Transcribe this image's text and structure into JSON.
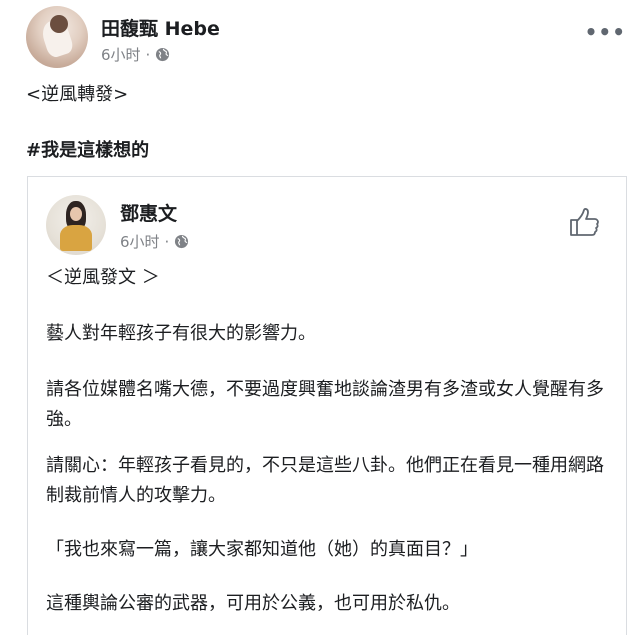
{
  "post": {
    "author": "田馥甄 Hebe",
    "time": "6小时",
    "separator": "·",
    "line1": "<逆風轉發>",
    "line2": "#我是這樣想的",
    "more_label": "•••",
    "icons": {
      "avatar": "author-avatar",
      "globe": "globe-icon",
      "more": "more-options-icon"
    }
  },
  "shared": {
    "author": "鄧惠文",
    "time": "6小时",
    "separator": "·",
    "paragraphs": [
      "＜逆風發文 ＞",
      "藝人對年輕孩子有很大的影響力。",
      "請各位媒體名嘴大德，不要過度興奮地談論渣男有多渣或女人覺醒有多強。",
      "請關心：年輕孩子看見的，不只是這些八卦。他們正在看見一種用網路制裁前情人的攻擊力。",
      "「我也來寫一篇，讓大家都知道他（她）的真面目？」",
      "這種輿論公審的武器，可用於公義，也可用於私仇。"
    ],
    "icons": {
      "avatar": "shared-author-avatar",
      "globe": "globe-icon",
      "like": "thumbs-up-icon"
    }
  },
  "colors": {
    "text": "#1c1e21",
    "meta": "#7f8287",
    "border": "#dadde1"
  }
}
